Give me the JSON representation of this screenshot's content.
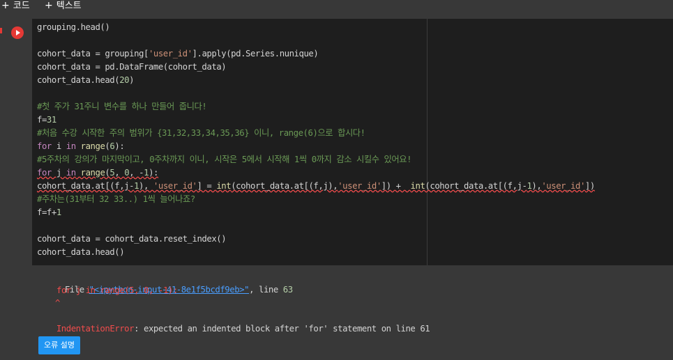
{
  "toolbar": {
    "add_code": "코드",
    "add_text": "텍스트"
  },
  "code_lines": [
    "grouping.head()",
    "",
    "cohort_data = grouping['user_id'].apply(pd.Series.nunique)",
    "cohort_data = pd.DataFrame(cohort_data)",
    "cohort_data.head(20)",
    "",
    "#첫 주가 31주니 변수를 하나 만들어 줍니다!",
    "f=31",
    "#처음 수강 시작한 주의 범위가 {31,32,33,34,35,36} 이니, range(6)으로 합시다!",
    "for i in range(6):",
    "#5주차의 강의가 마지막이고, 0주차까지 이니, 시작은 5에서 시작해 1씩 0까지 감소 시킬수 있어요!",
    "for j in range(5, 0, -1):",
    "cohort_data.at[(f,j-1), 'user_id'] = int(cohort_data.at[(f,j),'user_id']) +  int(cohort_data.at[(f,j-1),'user_id'])",
    "#주차는(31부터 32 33..) 1씩 늘어나죠?",
    "f=f+1",
    "",
    "cohort_data = cohort_data.reset_index()",
    "cohort_data.head()"
  ],
  "output": {
    "file_prefix": "File ",
    "file_link": "\"<ipython-input-41-8e1f5bcdf9eb>\"",
    "line_suffix": ", line ",
    "line_no": "63",
    "code_echo": "for j in range(5, 0, -1):",
    "caret": "^",
    "error_name": "IndentationError",
    "error_msg": ": expected an indented block after 'for' statement on line 61",
    "explain_button": "오류 설명"
  },
  "colors": {
    "keyword": "#c586c0",
    "string": "#ce9178",
    "number": "#b5cea8",
    "comment": "#6a9955",
    "error": "#f14c4c",
    "link": "#4a9eff",
    "button": "#2196f3"
  }
}
